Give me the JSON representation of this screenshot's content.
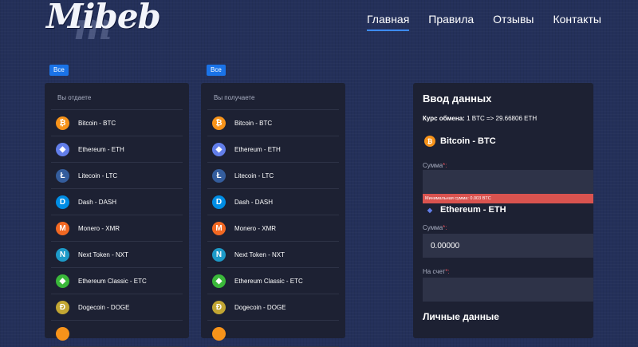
{
  "brand": {
    "logo_text": "Mibeb"
  },
  "nav": {
    "items": [
      {
        "label": "Главная",
        "active": true
      },
      {
        "label": "Правила",
        "active": false
      },
      {
        "label": "Отзывы",
        "active": false
      },
      {
        "label": "Контакты",
        "active": false
      }
    ]
  },
  "give": {
    "filter": "Все",
    "header": "Вы отдаете",
    "items": [
      {
        "label": "Bitcoin - BTC",
        "icon": "bitcoin-icon",
        "color": "#f7931a",
        "glyph": "₿"
      },
      {
        "label": "Ethereum - ETH",
        "icon": "ethereum-icon",
        "color": "#627eea",
        "glyph": "◆"
      },
      {
        "label": "Litecoin - LTC",
        "icon": "litecoin-icon",
        "color": "#345d9d",
        "glyph": "Ł"
      },
      {
        "label": "Dash - DASH",
        "icon": "dash-icon",
        "color": "#008de4",
        "glyph": "D"
      },
      {
        "label": "Monero - XMR",
        "icon": "monero-icon",
        "color": "#f26822",
        "glyph": "M"
      },
      {
        "label": "Next Token - NXT",
        "icon": "nxt-icon",
        "color": "#1d9ac8",
        "glyph": "N"
      },
      {
        "label": "Ethereum Classic - ETC",
        "icon": "ethereum-classic-icon",
        "color": "#3ab83a",
        "glyph": "◆"
      },
      {
        "label": "Dogecoin - DOGE",
        "icon": "dogecoin-icon",
        "color": "#c2a633",
        "glyph": "Ð"
      },
      {
        "label": "",
        "icon": "coin-icon",
        "color": "#f7931a",
        "glyph": ""
      }
    ]
  },
  "receive": {
    "filter": "Все",
    "header": "Вы получаете",
    "items": [
      {
        "label": "Bitcoin - BTC",
        "icon": "bitcoin-icon",
        "color": "#f7931a",
        "glyph": "₿"
      },
      {
        "label": "Ethereum - ETH",
        "icon": "ethereum-icon",
        "color": "#627eea",
        "glyph": "◆"
      },
      {
        "label": "Litecoin - LTC",
        "icon": "litecoin-icon",
        "color": "#345d9d",
        "glyph": "Ł"
      },
      {
        "label": "Dash - DASH",
        "icon": "dash-icon",
        "color": "#008de4",
        "glyph": "D"
      },
      {
        "label": "Monero - XMR",
        "icon": "monero-icon",
        "color": "#f26822",
        "glyph": "M"
      },
      {
        "label": "Next Token - NXT",
        "icon": "nxt-icon",
        "color": "#1d9ac8",
        "glyph": "N"
      },
      {
        "label": "Ethereum Classic - ETC",
        "icon": "ethereum-classic-icon",
        "color": "#3ab83a",
        "glyph": "◆"
      },
      {
        "label": "Dogecoin - DOGE",
        "icon": "dogecoin-icon",
        "color": "#c2a633",
        "glyph": "Ð"
      },
      {
        "label": "",
        "icon": "coin-icon",
        "color": "#f7931a",
        "glyph": ""
      }
    ]
  },
  "form": {
    "title": "Ввод данных",
    "rate_label": "Курс обмена:",
    "rate_value": "1 BTC => 29.66806 ETH",
    "give_coin": {
      "label": "Bitcoin - BTC",
      "color": "#f7931a",
      "glyph": "₿"
    },
    "give_amount_label": "Сумма",
    "give_amount_value": "",
    "min_error": "Минимальная сумма: 0.003 BTC",
    "get_coin": {
      "label": "Ethereum - ETH",
      "color": "#627eea",
      "glyph": "◆"
    },
    "get_amount_label": "Сумма",
    "get_amount_value": "0.00000",
    "account_label": "На счет",
    "account_value": "",
    "required_mark": "*:",
    "personal_title": "Личные данные"
  },
  "colors": {
    "accent": "#3d8bfd",
    "panel": "#1d2133",
    "error": "#d9534f"
  }
}
